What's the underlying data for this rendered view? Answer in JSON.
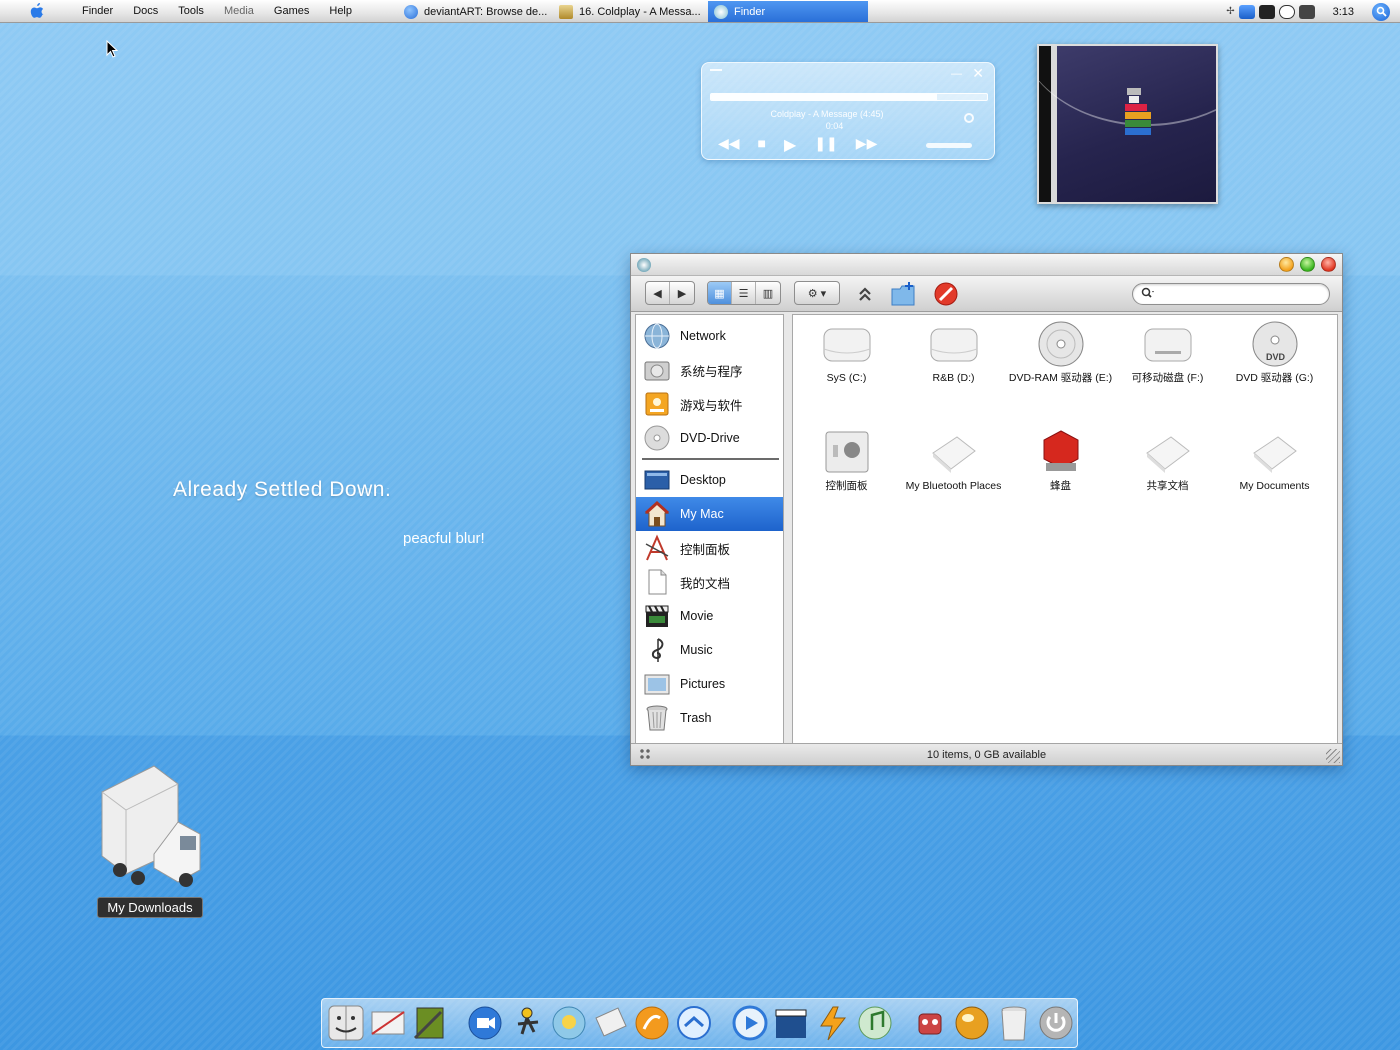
{
  "menubar": {
    "items": [
      "Finder",
      "Docs",
      "Tools",
      "Media",
      "Games",
      "Help"
    ],
    "tasks": [
      {
        "label": "deviantART: Browse de...",
        "color": "#3a7fd5"
      },
      {
        "label": "16. Coldplay - A Messa...",
        "color": "#c8a24a"
      },
      {
        "label": "Finder",
        "color": "#ffffff"
      }
    ],
    "clock": "3:13"
  },
  "desktop": {
    "tagline": "Already Settled Down.",
    "subline": "peacful blur!",
    "download_icon_label": "My Downloads"
  },
  "player": {
    "track": "Coldplay - A Message (4:45)",
    "time": "0:04",
    "progress": 0.82,
    "buttons": [
      "rewind",
      "stop",
      "play",
      "pause",
      "fast-forward"
    ]
  },
  "finder": {
    "sidebar": {
      "devices": [
        {
          "label": "Network",
          "icon": "network-globe-icon"
        },
        {
          "label": "系统与程序",
          "icon": "hard-drive-icon"
        },
        {
          "label": "游戏与软件",
          "icon": "orange-drive-icon"
        },
        {
          "label": "DVD-Drive",
          "icon": "dvd-icon"
        }
      ],
      "places": [
        {
          "label": "Desktop",
          "icon": "desktop-icon"
        },
        {
          "label": "My Mac",
          "icon": "home-icon",
          "selected": true
        },
        {
          "label": "控制面板",
          "icon": "control-panel-icon"
        },
        {
          "label": "我的文档",
          "icon": "document-icon"
        },
        {
          "label": "Movie",
          "icon": "movie-clapper-icon"
        },
        {
          "label": "Music",
          "icon": "music-icon"
        },
        {
          "label": "Pictures",
          "icon": "pictures-icon"
        },
        {
          "label": "Trash",
          "icon": "trash-icon"
        }
      ]
    },
    "items": [
      {
        "label": "SyS (C:)",
        "icon": "drive-icon"
      },
      {
        "label": "R&B (D:)",
        "icon": "drive-icon"
      },
      {
        "label": "DVD-RAM 驱动器 (E:)",
        "icon": "disc-icon"
      },
      {
        "label": "可移动磁盘 (F:)",
        "icon": "removable-drive-icon"
      },
      {
        "label": "DVD 驱动器 (G:)",
        "icon": "dvd-disc-icon"
      },
      {
        "label": "控制面板",
        "icon": "control-panel-icon"
      },
      {
        "label": "My Bluetooth Places",
        "icon": "folder-icon"
      },
      {
        "label": "蜂盘",
        "icon": "red-drive-icon"
      },
      {
        "label": "共享文档",
        "icon": "folder-icon"
      },
      {
        "label": "My Documents",
        "icon": "folder-icon"
      }
    ],
    "status": "10 items, 0 GB available",
    "search_placeholder": ""
  },
  "dock": {
    "icons": [
      "finder-icon",
      "mail-icon",
      "tools-icon",
      "video-chat-icon",
      "aim-icon",
      "messenger-icon",
      "mail-stamp-icon",
      "burn-icon",
      "safari-icon",
      "quicktime-icon",
      "movie-icon",
      "winamp-icon",
      "itunes-icon",
      "robot-icon",
      "globe-icon",
      "trash-icon",
      "power-icon"
    ]
  }
}
